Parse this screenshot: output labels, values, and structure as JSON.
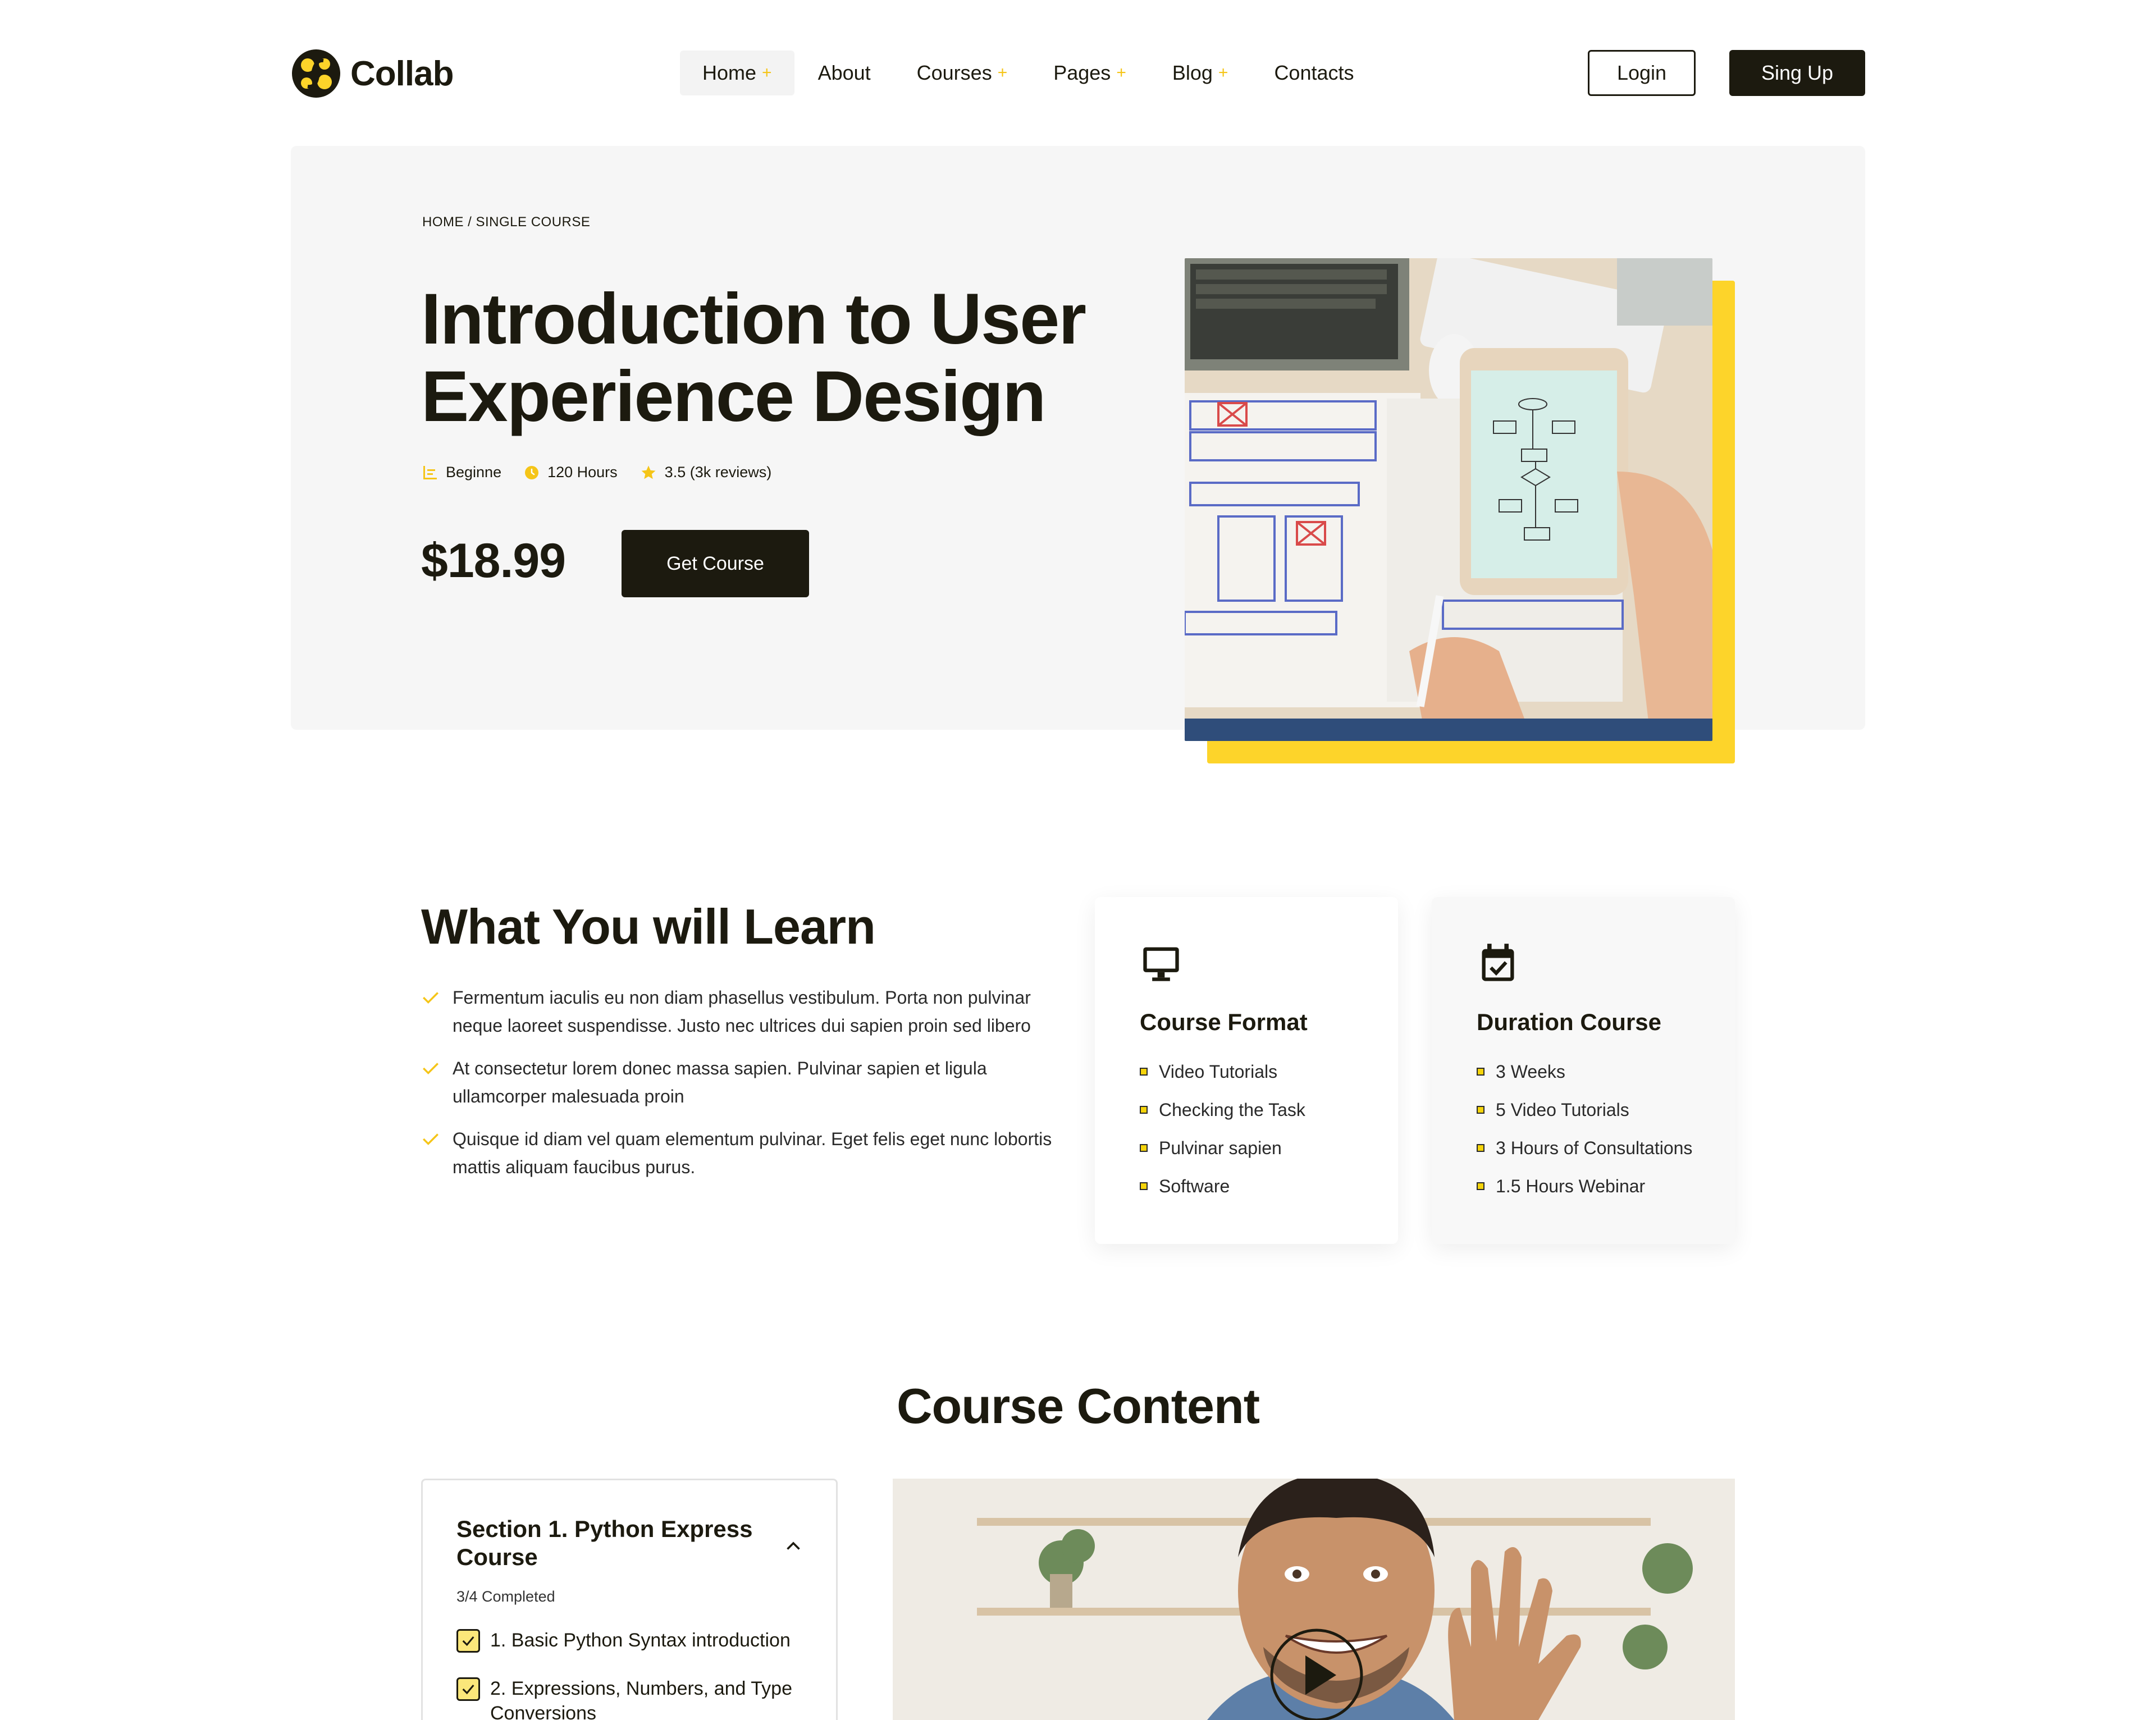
{
  "header": {
    "logo_text": "Collab",
    "nav": [
      {
        "label": "Home",
        "has_submenu": true,
        "active": true
      },
      {
        "label": "About",
        "has_submenu": false
      },
      {
        "label": "Courses",
        "has_submenu": true
      },
      {
        "label": "Pages",
        "has_submenu": true
      },
      {
        "label": "Blog",
        "has_submenu": true
      },
      {
        "label": "Contacts",
        "has_submenu": false
      }
    ],
    "submenu_marker": "+",
    "login_label": "Login",
    "signup_label": "Sing Up"
  },
  "hero": {
    "breadcrumb": "HOME / SINGLE COURSE",
    "title": "Introduction to User Experience Design",
    "level": "Beginne",
    "hours": "120 Hours",
    "rating": "3.5 (3k reviews)",
    "price": "$18.99",
    "cta_label": "Get Course",
    "image_icon": "tablet-wireframe-photo"
  },
  "learn": {
    "title": "What You will Learn",
    "items": [
      "Fermentum iaculis eu non diam phasellus vestibulum. Porta non pulvinar neque laoreet suspendisse. Justo nec ultrices dui sapien proin sed libero",
      "At consectetur lorem donec massa sapien. Pulvinar sapien et ligula ullamcorper malesuada proin",
      "Quisque id diam vel quam elementum pulvinar. Eget felis eget nunc lobortis mattis aliquam faucibus purus."
    ]
  },
  "cards": [
    {
      "icon": "monitor-icon",
      "title": "Course Format",
      "items": [
        "Video Tutorials",
        "Checking the Task",
        "Pulvinar sapien",
        "Software"
      ]
    },
    {
      "icon": "calendar-check-icon",
      "title": "Duration Course",
      "items": [
        "3 Weeks",
        "5 Video Tutorials",
        "3 Hours of Consultations",
        "1.5 Hours Webinar"
      ]
    }
  ],
  "course_content": {
    "title": "Course Content",
    "section_title": "Section 1.  Python Express Course",
    "section_progress": "3/4 Completed",
    "lessons": [
      "1. Basic Python Syntax introduction",
      "2. Expressions, Numbers, and Type Conversions"
    ],
    "video_icon": "play-icon"
  },
  "colors": {
    "primary_dark": "#1c1a0f",
    "accent_yellow": "#fdd42a",
    "hero_bg": "#f6f6f6"
  }
}
